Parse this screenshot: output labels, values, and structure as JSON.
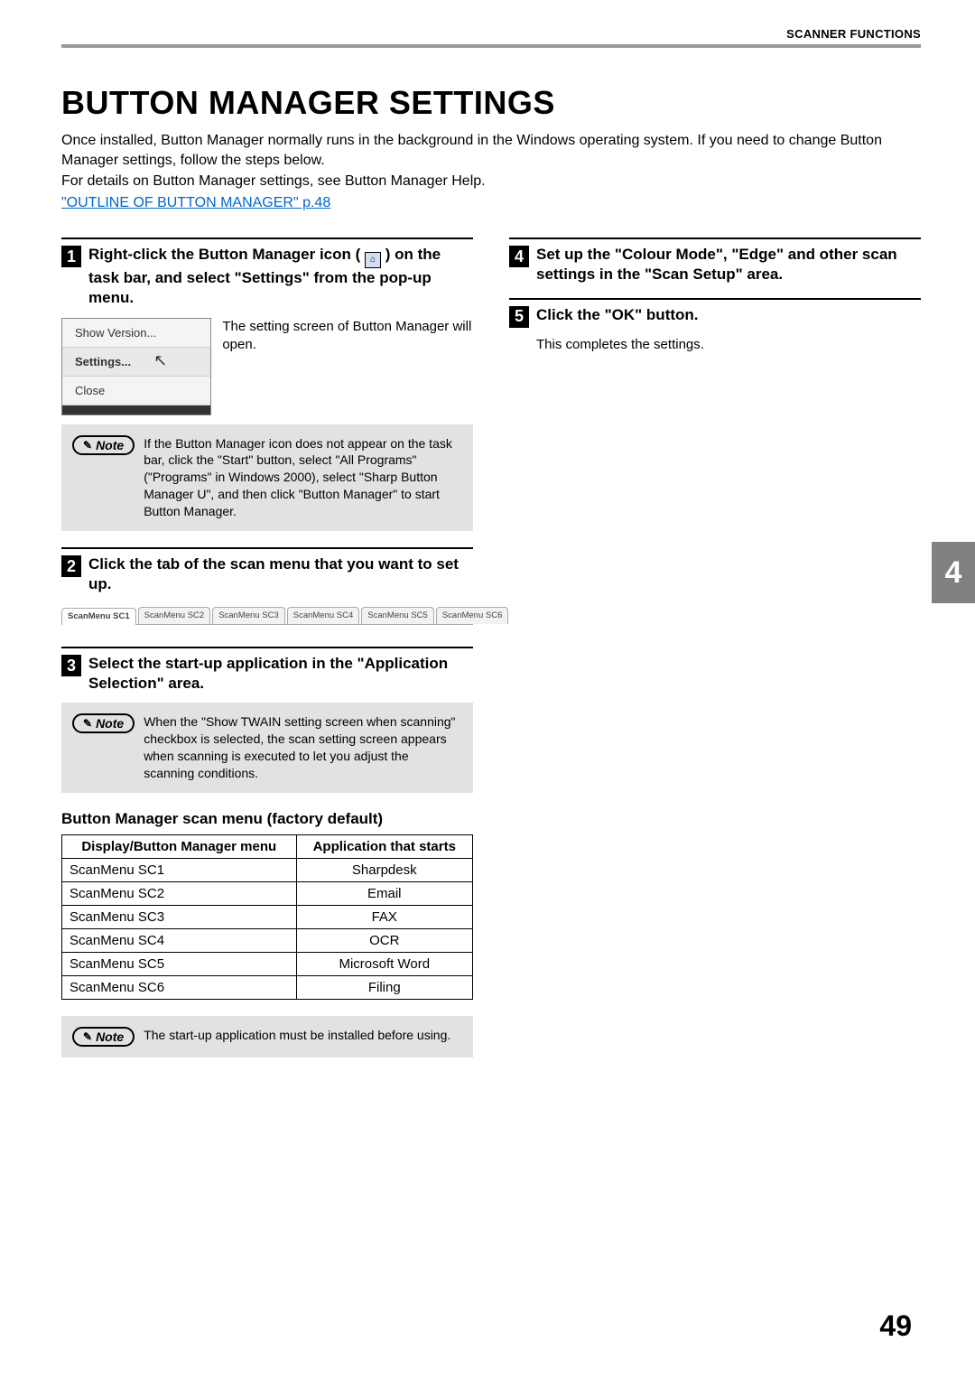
{
  "header": {
    "section": "SCANNER FUNCTIONS"
  },
  "title": "BUTTON MANAGER SETTINGS",
  "intro": {
    "p1": "Once installed, Button Manager normally runs in the background in the Windows operating system. If you need to change Button Manager settings, follow the steps below.",
    "p2": "For details on Button Manager settings, see Button Manager Help.",
    "link": "\"OUTLINE OF BUTTON MANAGER\" p.48"
  },
  "step1": {
    "num": "1",
    "title_a": "Right-click the Button Manager icon",
    "title_b": "( ",
    "title_c": " ) on the task bar, and select \"Settings\" from the pop-up menu.",
    "menu": {
      "show_version": "Show Version...",
      "settings": "Settings...",
      "close": "Close"
    },
    "open_text": "The setting screen of Button Manager will open."
  },
  "note1": {
    "label": "Note",
    "text": "If the Button Manager icon does not appear on the task bar, click the \"Start\" button, select \"All Programs\" (\"Programs\" in Windows 2000), select \"Sharp Button Manager U\", and then click \"Button Manager\" to start Button Manager."
  },
  "step2": {
    "num": "2",
    "title": "Click the tab of the scan menu that you want to set up.",
    "tabs": [
      "ScanMenu SC1",
      "ScanMenu SC2",
      "ScanMenu SC3",
      "ScanMenu SC4",
      "ScanMenu SC5",
      "ScanMenu SC6"
    ]
  },
  "step3": {
    "num": "3",
    "title": "Select the start-up application in the \"Application Selection\" area."
  },
  "note2": {
    "label": "Note",
    "text": "When the \"Show TWAIN setting screen when scanning\" checkbox is selected, the scan setting screen appears when scanning is executed to let you adjust the scanning conditions."
  },
  "defaults": {
    "heading": "Button Manager scan menu (factory default)",
    "headers": {
      "a": "Display/Button Manager menu",
      "b": "Application that starts"
    },
    "rows": [
      {
        "a": "ScanMenu SC1",
        "b": "Sharpdesk"
      },
      {
        "a": "ScanMenu SC2",
        "b": "Email"
      },
      {
        "a": "ScanMenu SC3",
        "b": "FAX"
      },
      {
        "a": "ScanMenu SC4",
        "b": "OCR"
      },
      {
        "a": "ScanMenu SC5",
        "b": "Microsoft Word"
      },
      {
        "a": "ScanMenu SC6",
        "b": "Filing"
      }
    ]
  },
  "note3": {
    "label": "Note",
    "text": "The start-up application must be installed before using."
  },
  "step4": {
    "num": "4",
    "title": "Set up the \"Colour Mode\", \"Edge\" and other scan settings in the \"Scan Setup\" area."
  },
  "step5": {
    "num": "5",
    "title": "Click the \"OK\" button.",
    "body": "This completes the settings."
  },
  "chapter_tab": "4",
  "page_number": "49"
}
